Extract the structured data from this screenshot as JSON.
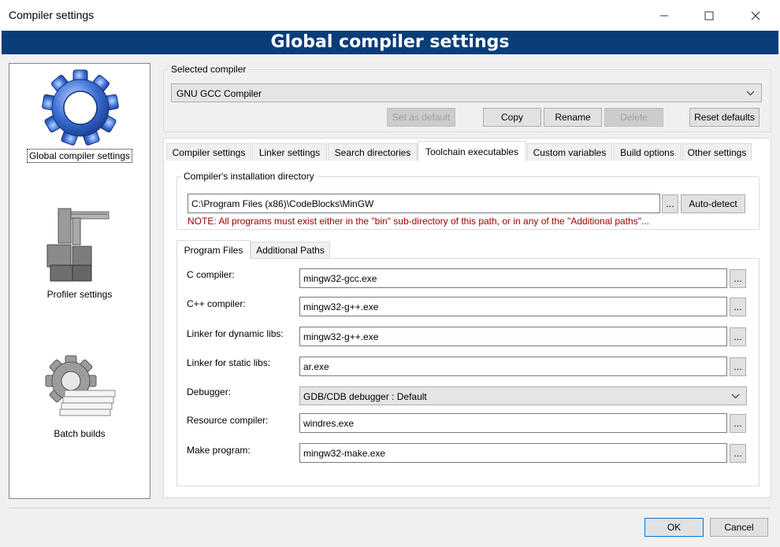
{
  "window": {
    "title": "Compiler settings"
  },
  "banner": {
    "title": "Global compiler settings"
  },
  "categories": [
    {
      "label": "Global compiler settings",
      "icon": "gear-icon"
    },
    {
      "label": "Profiler settings",
      "icon": "caliper-icon"
    },
    {
      "label": "Batch builds",
      "icon": "batch-gear-icon"
    }
  ],
  "selected_compiler": {
    "group_title": "Selected compiler",
    "value": "GNU GCC Compiler",
    "set_default": "Set as default",
    "copy": "Copy",
    "rename": "Rename",
    "delete": "Delete",
    "reset": "Reset defaults"
  },
  "tabs": [
    "Compiler settings",
    "Linker settings",
    "Search directories",
    "Toolchain executables",
    "Custom variables",
    "Build options",
    "Other settings"
  ],
  "install_dir": {
    "group_title": "Compiler's installation directory",
    "value": "C:\\Program Files (x86)\\CodeBlocks\\MinGW",
    "browse": "...",
    "autodetect": "Auto-detect",
    "note": "NOTE: All programs must exist either in the \"bin\" sub-directory of this path, or in any of the \"Additional paths\"..."
  },
  "subtabs": [
    "Program Files",
    "Additional Paths"
  ],
  "programs": {
    "c_label": "C compiler:",
    "c_value": "mingw32-gcc.exe",
    "cpp_label": "C++ compiler:",
    "cpp_value": "mingw32-g++.exe",
    "dyn_label": "Linker for dynamic libs:",
    "dyn_value": "mingw32-g++.exe",
    "static_label": "Linker for static libs:",
    "static_value": "ar.exe",
    "dbg_label": "Debugger:",
    "dbg_value": "GDB/CDB debugger : Default",
    "res_label": "Resource compiler:",
    "res_value": "windres.exe",
    "make_label": "Make program:",
    "make_value": "mingw32-make.exe",
    "browse": "..."
  },
  "footer": {
    "ok": "OK",
    "cancel": "Cancel"
  }
}
